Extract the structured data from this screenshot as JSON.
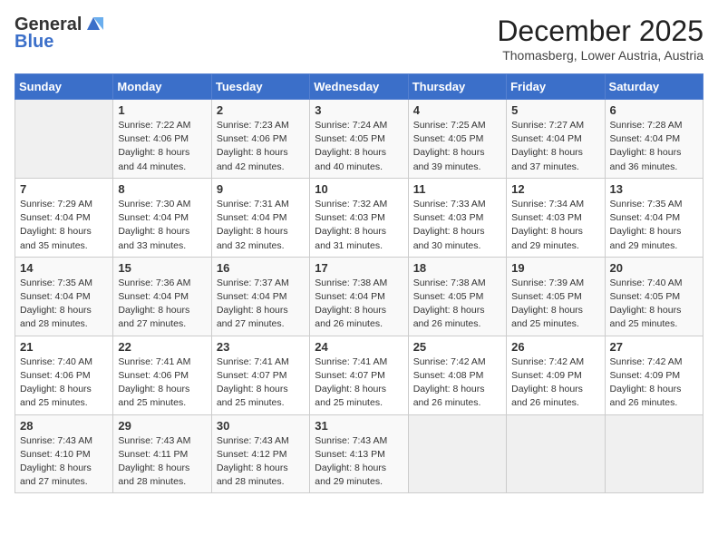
{
  "logo": {
    "general": "General",
    "blue": "Blue"
  },
  "title": "December 2025",
  "location": "Thomasberg, Lower Austria, Austria",
  "days_of_week": [
    "Sunday",
    "Monday",
    "Tuesday",
    "Wednesday",
    "Thursday",
    "Friday",
    "Saturday"
  ],
  "weeks": [
    [
      {
        "day": "",
        "content": ""
      },
      {
        "day": "1",
        "content": "Sunrise: 7:22 AM\nSunset: 4:06 PM\nDaylight: 8 hours\nand 44 minutes."
      },
      {
        "day": "2",
        "content": "Sunrise: 7:23 AM\nSunset: 4:06 PM\nDaylight: 8 hours\nand 42 minutes."
      },
      {
        "day": "3",
        "content": "Sunrise: 7:24 AM\nSunset: 4:05 PM\nDaylight: 8 hours\nand 40 minutes."
      },
      {
        "day": "4",
        "content": "Sunrise: 7:25 AM\nSunset: 4:05 PM\nDaylight: 8 hours\nand 39 minutes."
      },
      {
        "day": "5",
        "content": "Sunrise: 7:27 AM\nSunset: 4:04 PM\nDaylight: 8 hours\nand 37 minutes."
      },
      {
        "day": "6",
        "content": "Sunrise: 7:28 AM\nSunset: 4:04 PM\nDaylight: 8 hours\nand 36 minutes."
      }
    ],
    [
      {
        "day": "7",
        "content": "Sunrise: 7:29 AM\nSunset: 4:04 PM\nDaylight: 8 hours\nand 35 minutes."
      },
      {
        "day": "8",
        "content": "Sunrise: 7:30 AM\nSunset: 4:04 PM\nDaylight: 8 hours\nand 33 minutes."
      },
      {
        "day": "9",
        "content": "Sunrise: 7:31 AM\nSunset: 4:04 PM\nDaylight: 8 hours\nand 32 minutes."
      },
      {
        "day": "10",
        "content": "Sunrise: 7:32 AM\nSunset: 4:03 PM\nDaylight: 8 hours\nand 31 minutes."
      },
      {
        "day": "11",
        "content": "Sunrise: 7:33 AM\nSunset: 4:03 PM\nDaylight: 8 hours\nand 30 minutes."
      },
      {
        "day": "12",
        "content": "Sunrise: 7:34 AM\nSunset: 4:03 PM\nDaylight: 8 hours\nand 29 minutes."
      },
      {
        "day": "13",
        "content": "Sunrise: 7:35 AM\nSunset: 4:04 PM\nDaylight: 8 hours\nand 29 minutes."
      }
    ],
    [
      {
        "day": "14",
        "content": "Sunrise: 7:35 AM\nSunset: 4:04 PM\nDaylight: 8 hours\nand 28 minutes."
      },
      {
        "day": "15",
        "content": "Sunrise: 7:36 AM\nSunset: 4:04 PM\nDaylight: 8 hours\nand 27 minutes."
      },
      {
        "day": "16",
        "content": "Sunrise: 7:37 AM\nSunset: 4:04 PM\nDaylight: 8 hours\nand 27 minutes."
      },
      {
        "day": "17",
        "content": "Sunrise: 7:38 AM\nSunset: 4:04 PM\nDaylight: 8 hours\nand 26 minutes."
      },
      {
        "day": "18",
        "content": "Sunrise: 7:38 AM\nSunset: 4:05 PM\nDaylight: 8 hours\nand 26 minutes."
      },
      {
        "day": "19",
        "content": "Sunrise: 7:39 AM\nSunset: 4:05 PM\nDaylight: 8 hours\nand 25 minutes."
      },
      {
        "day": "20",
        "content": "Sunrise: 7:40 AM\nSunset: 4:05 PM\nDaylight: 8 hours\nand 25 minutes."
      }
    ],
    [
      {
        "day": "21",
        "content": "Sunrise: 7:40 AM\nSunset: 4:06 PM\nDaylight: 8 hours\nand 25 minutes."
      },
      {
        "day": "22",
        "content": "Sunrise: 7:41 AM\nSunset: 4:06 PM\nDaylight: 8 hours\nand 25 minutes."
      },
      {
        "day": "23",
        "content": "Sunrise: 7:41 AM\nSunset: 4:07 PM\nDaylight: 8 hours\nand 25 minutes."
      },
      {
        "day": "24",
        "content": "Sunrise: 7:41 AM\nSunset: 4:07 PM\nDaylight: 8 hours\nand 25 minutes."
      },
      {
        "day": "25",
        "content": "Sunrise: 7:42 AM\nSunset: 4:08 PM\nDaylight: 8 hours\nand 26 minutes."
      },
      {
        "day": "26",
        "content": "Sunrise: 7:42 AM\nSunset: 4:09 PM\nDaylight: 8 hours\nand 26 minutes."
      },
      {
        "day": "27",
        "content": "Sunrise: 7:42 AM\nSunset: 4:09 PM\nDaylight: 8 hours\nand 26 minutes."
      }
    ],
    [
      {
        "day": "28",
        "content": "Sunrise: 7:43 AM\nSunset: 4:10 PM\nDaylight: 8 hours\nand 27 minutes."
      },
      {
        "day": "29",
        "content": "Sunrise: 7:43 AM\nSunset: 4:11 PM\nDaylight: 8 hours\nand 28 minutes."
      },
      {
        "day": "30",
        "content": "Sunrise: 7:43 AM\nSunset: 4:12 PM\nDaylight: 8 hours\nand 28 minutes."
      },
      {
        "day": "31",
        "content": "Sunrise: 7:43 AM\nSunset: 4:13 PM\nDaylight: 8 hours\nand 29 minutes."
      },
      {
        "day": "",
        "content": ""
      },
      {
        "day": "",
        "content": ""
      },
      {
        "day": "",
        "content": ""
      }
    ]
  ]
}
